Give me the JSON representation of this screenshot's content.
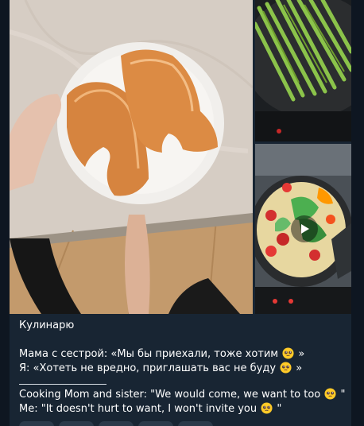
{
  "post": {
    "caption": {
      "title": "Кулинарю",
      "ru_line1_text": "Мама с сестрой: «Мы бы приехали, тоже хотим",
      "ru_line1_end": " »",
      "ru_line2_text": "Я: «Хотеть не вредно, приглашать вас не буду",
      "ru_line2_end": " »",
      "en_line1_text": "Cooking Mom and sister: \"We would come, we want to too",
      "en_line1_end": " \"",
      "en_line2_text": "Me: \"It doesn't hurt to want, I won't invite you",
      "en_line2_end": " \""
    },
    "emoji": "pleading-face-icon",
    "media": [
      {
        "kind": "photo",
        "subject": "salmon steaks on a white plate"
      },
      {
        "kind": "photo",
        "subject": "asparagus in a frying pan"
      },
      {
        "kind": "video",
        "subject": "vegetable omelette in a pan"
      }
    ]
  },
  "colors": {
    "background": "#0e1621",
    "bubble": "#182533",
    "text": "#ffffff"
  }
}
